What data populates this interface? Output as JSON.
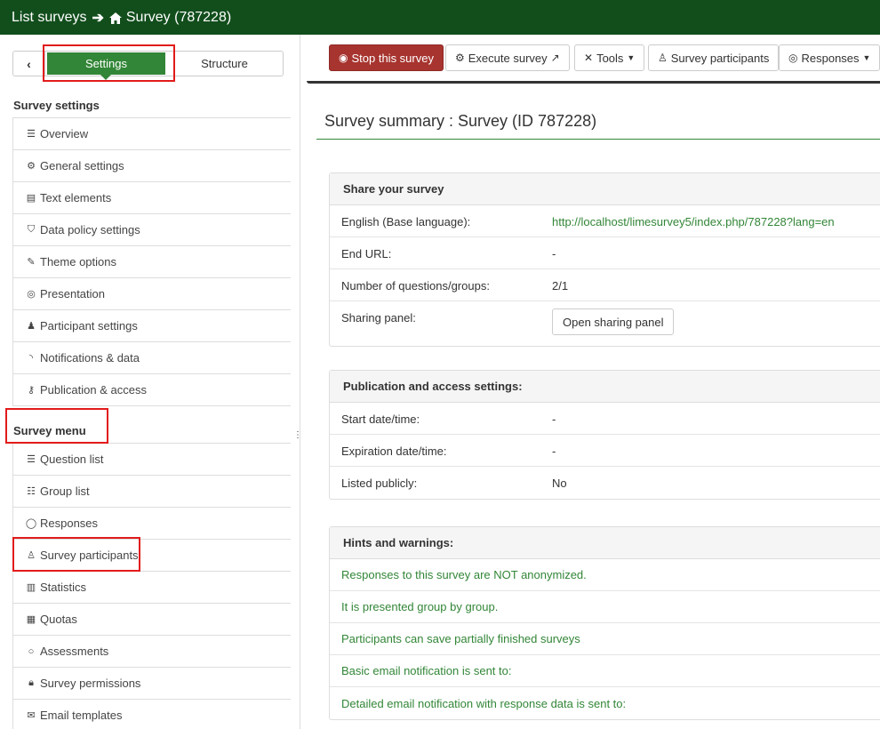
{
  "breadcrumb": {
    "list_surveys": "List surveys",
    "survey": "Survey (787228)"
  },
  "sidebar": {
    "tabs": {
      "settings": "Settings",
      "structure": "Structure"
    },
    "survey_settings_title": "Survey settings",
    "settings_items": [
      {
        "label": "Overview",
        "icon": "list-icon"
      },
      {
        "label": "General settings",
        "icon": "gears-icon"
      },
      {
        "label": "Text elements",
        "icon": "file-text-icon"
      },
      {
        "label": "Data policy settings",
        "icon": "shield-icon"
      },
      {
        "label": "Theme options",
        "icon": "paint-brush-icon"
      },
      {
        "label": "Presentation",
        "icon": "eye-slash-icon"
      },
      {
        "label": "Participant settings",
        "icon": "users-icon"
      },
      {
        "label": "Notifications & data",
        "icon": "rss-icon"
      },
      {
        "label": "Publication & access",
        "icon": "key-icon"
      }
    ],
    "survey_menu_title": "Survey menu",
    "menu_items": [
      {
        "label": "Question list",
        "icon": "list-icon"
      },
      {
        "label": "Group list",
        "icon": "th-list-icon"
      },
      {
        "label": "Responses",
        "icon": "comment-icon"
      },
      {
        "label": "Survey participants",
        "icon": "user-icon"
      },
      {
        "label": "Statistics",
        "icon": "bar-chart-icon"
      },
      {
        "label": "Quotas",
        "icon": "tasks-icon"
      },
      {
        "label": "Assessments",
        "icon": "comment-o-icon"
      },
      {
        "label": "Survey permissions",
        "icon": "lock-icon"
      },
      {
        "label": "Email templates",
        "icon": "envelope-icon"
      }
    ]
  },
  "toolbar": {
    "stop": "Stop this survey",
    "execute": "Execute survey",
    "tools": "Tools",
    "participants": "Survey participants",
    "responses": "Responses"
  },
  "main": {
    "title": "Survey summary : Survey (ID 787228)",
    "share": {
      "heading": "Share your survey",
      "rows": [
        {
          "label": "English (Base language):",
          "value": "http://localhost/limesurvey5/index.php/787228?lang=en"
        },
        {
          "label": "End URL:",
          "value": "-"
        },
        {
          "label": "Number of questions/groups:",
          "value": "2/1"
        },
        {
          "label": "Sharing panel:",
          "value": ""
        }
      ],
      "sharing_button": "Open sharing panel"
    },
    "publication": {
      "heading": "Publication and access settings:",
      "rows": [
        {
          "label": "Start date/time:",
          "value": "-"
        },
        {
          "label": "Expiration date/time:",
          "value": "-"
        },
        {
          "label": "Listed publicly:",
          "value": "No"
        }
      ]
    },
    "hints": {
      "heading": "Hints and warnings:",
      "items": [
        "Responses to this survey are NOT anonymized.",
        "It is presented group by group.",
        "Participants can save partially finished surveys",
        "Basic email notification is sent to:",
        "Detailed email notification with response data is sent to:"
      ]
    }
  },
  "colors": {
    "topbar": "#124e1c",
    "accent": "#328637",
    "danger": "#a7342f",
    "highlight": "#e21b1b"
  }
}
